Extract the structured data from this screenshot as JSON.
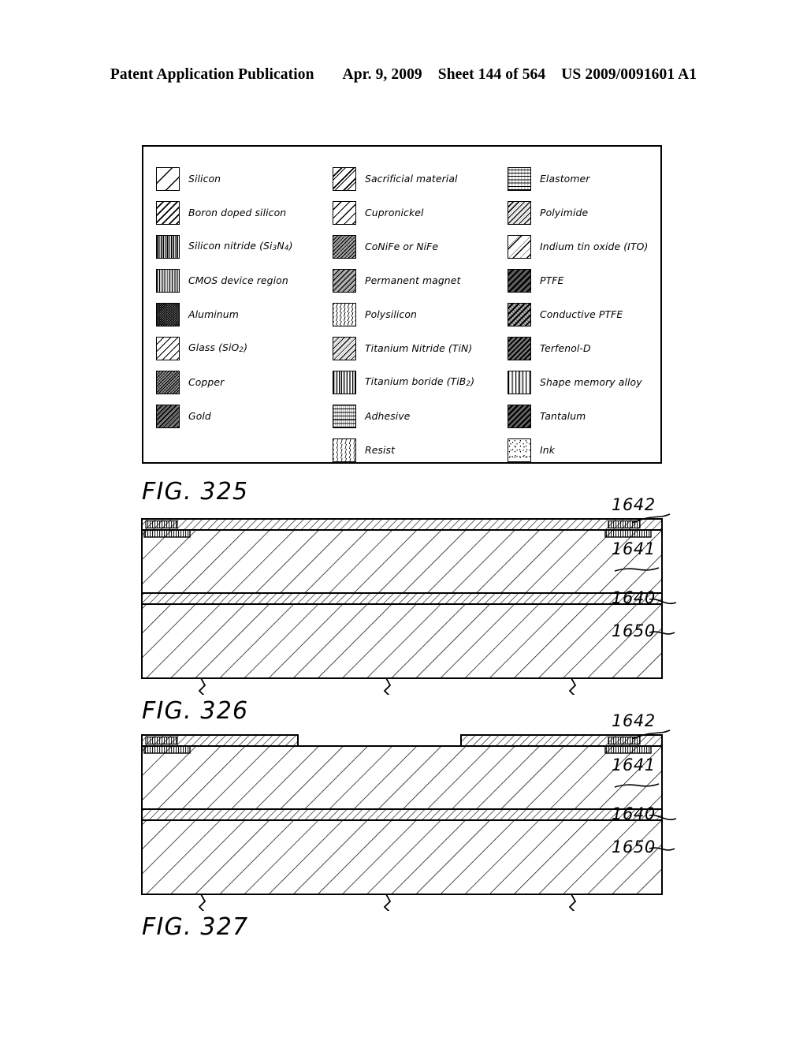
{
  "header": {
    "publication": "Patent Application Publication",
    "date": "Apr. 9, 2009",
    "sheet": "Sheet 144 of 564",
    "doc_number": "US 2009/0091601 A1"
  },
  "legend": {
    "columns": [
      {
        "items": [
          {
            "label": "Silicon",
            "pattern": "p-silicon"
          },
          {
            "label": "Boron doped silicon",
            "pattern": "p-boron"
          },
          {
            "label": "Silicon nitride (Si3N4)",
            "pattern": "p-sinitride",
            "rich": [
              "Silicon nitride (Si",
              "3",
              "N",
              "4",
              ")"
            ]
          },
          {
            "label": "CMOS device region",
            "pattern": "p-cmos"
          },
          {
            "label": "Aluminum",
            "pattern": "p-aluminum"
          },
          {
            "label": "Glass (SiO2)",
            "pattern": "p-glass",
            "rich": [
              "Glass (SiO",
              "2",
              ")"
            ]
          },
          {
            "label": "Copper",
            "pattern": "p-copper"
          },
          {
            "label": "Gold",
            "pattern": "p-gold"
          }
        ]
      },
      {
        "items": [
          {
            "label": "Sacrificial material",
            "pattern": "p-sacrificial"
          },
          {
            "label": "Cupronickel",
            "pattern": "p-cupronickel"
          },
          {
            "label": "CoNiFe or NiFe",
            "pattern": "p-conife"
          },
          {
            "label": "Permanent magnet",
            "pattern": "p-permmagnet"
          },
          {
            "label": "Polysilicon",
            "pattern": "p-polysilicon"
          },
          {
            "label": "Titanium Nitride (TiN)",
            "pattern": "p-tin"
          },
          {
            "label": "Titanium boride (TiB2)",
            "pattern": "p-tib2",
            "rich": [
              "Titanium boride (TiB",
              "2",
              ")"
            ]
          },
          {
            "label": "Adhesive",
            "pattern": "p-adhesive"
          },
          {
            "label": "Resist",
            "pattern": "p-resist"
          }
        ]
      },
      {
        "items": [
          {
            "label": "Elastomer",
            "pattern": "p-elastomer"
          },
          {
            "label": "Polyimide",
            "pattern": "p-polyimide"
          },
          {
            "label": "Indium tin oxide (ITO)",
            "pattern": "p-ito"
          },
          {
            "label": "PTFE",
            "pattern": "p-ptfe"
          },
          {
            "label": "Conductive PTFE",
            "pattern": "p-condptfe"
          },
          {
            "label": "Terfenol-D",
            "pattern": "p-terfenol"
          },
          {
            "label": "Shape memory alloy",
            "pattern": "p-sma"
          },
          {
            "label": "Tantalum",
            "pattern": "p-tantalum"
          },
          {
            "label": "Ink",
            "pattern": "p-ink"
          }
        ]
      }
    ]
  },
  "figures": {
    "fig325": {
      "caption": "FIG. 325"
    },
    "fig326": {
      "caption": "FIG. 326",
      "ref_numbers": [
        "1642",
        "1641",
        "1640",
        "1650"
      ],
      "description": "Cross-section: continuous top thin layer over silicon body with buried layer"
    },
    "fig327": {
      "caption": "FIG. 327",
      "ref_numbers": [
        "1642",
        "1641",
        "1640",
        "1650"
      ],
      "description": "Cross-section: patterned top thin layer with central gap over silicon body with buried layer"
    }
  }
}
